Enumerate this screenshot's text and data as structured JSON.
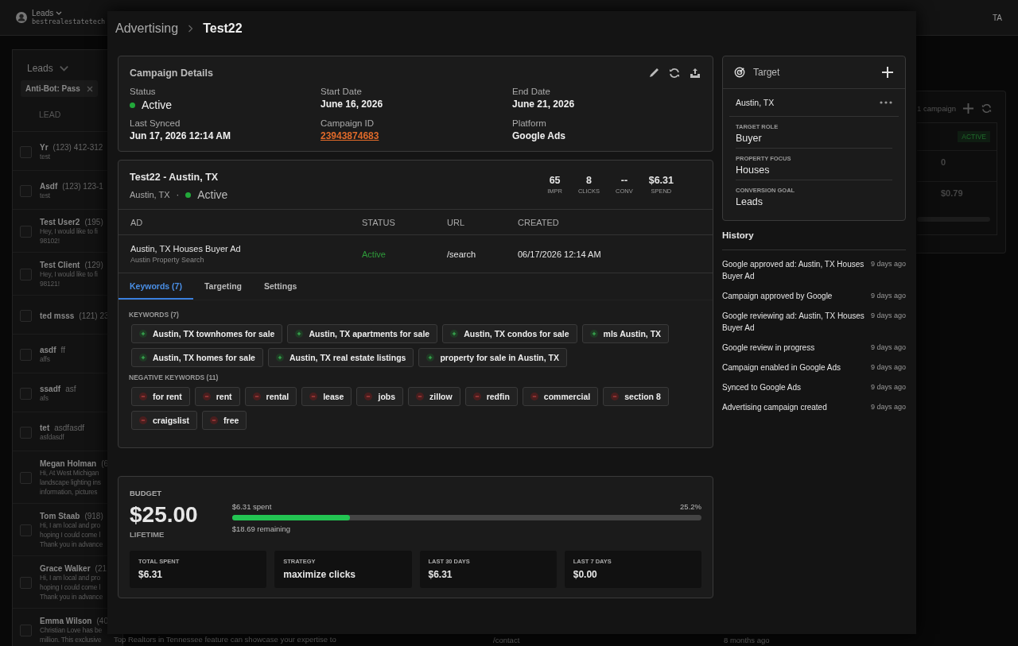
{
  "app_header": {
    "account_label": "Leads",
    "account_sub": "bestrealestatetech",
    "user_initials": "TA"
  },
  "leads_panel": {
    "title": "Leads",
    "filter_chip": "Anti-Bot: Pass",
    "column": "LEAD",
    "rows": [
      {
        "name": "Yr",
        "phone": "(123) 412-312",
        "preview": [
          "test"
        ],
        "checked": false
      },
      {
        "name": "Asdf",
        "phone": "(123) 123-1",
        "preview": [
          "test"
        ],
        "checked": false
      },
      {
        "name": "Test User2",
        "phone": "(195)",
        "preview": [
          "Hey, I would like to fi",
          "98102!"
        ],
        "checked": false
      },
      {
        "name": "Test Client",
        "phone": "(129)",
        "preview": [
          "Hey, I would like to fi",
          "98121!"
        ],
        "checked": false
      },
      {
        "name": "ted msss",
        "phone": "(121) 23",
        "preview": [],
        "checked": false
      },
      {
        "name": "asdf",
        "phone": "ff",
        "preview": [
          "affs"
        ],
        "checked": false
      },
      {
        "name": "ssadf",
        "phone": "asf",
        "preview": [
          "afs"
        ],
        "checked": false
      },
      {
        "name": "tet",
        "phone": "asdfasdf",
        "preview": [
          "asfdasdf"
        ],
        "checked": false
      },
      {
        "name": "Megan Holman",
        "phone": "(6",
        "preview": [
          "Hi, At West Michigan",
          "landscape lighting ins",
          "information, pictures"
        ],
        "checked": false
      },
      {
        "name": "Tom Staab",
        "phone": "(918)",
        "preview": [
          "Hi, I am local and pro",
          "hoping I could come l",
          "Thank you in advance"
        ],
        "checked": false
      },
      {
        "name": "Grace Walker",
        "phone": "(21",
        "preview": [
          "Hi, I am local and pro",
          "hoping I could come l",
          "Thank you in advance"
        ],
        "checked": false
      },
      {
        "name": "Emma Wilson",
        "phone": "(40",
        "preview": [
          "Christian Love has be",
          "million. This exclusive"
        ],
        "checked": false
      }
    ]
  },
  "background_panel": {
    "count": "1 campaign",
    "badge": "ACTIVE",
    "values": [
      "0",
      "$0.79"
    ]
  },
  "background_row": {
    "preview": "Top Realtors in Tennessee feature can showcase your expertise to",
    "url": "/contact",
    "time": "8 months ago"
  },
  "modal": {
    "breadcrumb": [
      "Advertising",
      "Test22"
    ],
    "campaign_details": {
      "title": "Campaign Details",
      "fields": [
        {
          "label": "Status",
          "value": "Active",
          "kind": "status",
          "active": true
        },
        {
          "label": "Start Date",
          "value": "June 16, 2026",
          "kind": "text"
        },
        {
          "label": "End Date",
          "value": "June 21, 2026",
          "kind": "text"
        },
        {
          "label": "Last Synced",
          "value": "Jun 17, 2026 12:14 AM",
          "kind": "text"
        },
        {
          "label": "Campaign ID",
          "value": "23943874683",
          "kind": "link"
        },
        {
          "label": "Platform",
          "value": "Google Ads",
          "kind": "text"
        }
      ]
    },
    "ad_group": {
      "title": "Test22 - Austin, TX",
      "location": "Austin, TX",
      "separator": "·",
      "status": "Active",
      "active": true,
      "stats": [
        {
          "value": "65",
          "label": "IMPR"
        },
        {
          "value": "8",
          "label": "CLICKS"
        },
        {
          "value": "--",
          "label": "CONV"
        },
        {
          "value": "$6.31",
          "label": "SPEND"
        }
      ],
      "table": {
        "columns": [
          "AD",
          "STATUS",
          "URL",
          "CREATED"
        ],
        "rows": [
          {
            "ad": "Austin, TX Houses Buyer Ad",
            "subtitle": "Austin Property Search",
            "status": "Active",
            "active": true,
            "url": "/search",
            "created": "06/17/2026 12:14 AM"
          }
        ]
      },
      "tabs": [
        {
          "label": "Keywords (7)",
          "selected": true
        },
        {
          "label": "Targeting",
          "selected": false
        },
        {
          "label": "Settings",
          "selected": false
        }
      ],
      "keyword_groups": [
        {
          "title": "KEYWORDS (7)",
          "kind": "positive",
          "keywords": [
            "Austin, TX townhomes for sale",
            "Austin, TX apartments for sale",
            "Austin, TX condos for sale",
            "mls Austin, TX",
            "Austin, TX homes for sale",
            "Austin, TX real estate listings",
            "property for sale in Austin, TX"
          ]
        },
        {
          "title": "NEGATIVE KEYWORDS (11)",
          "kind": "negative",
          "keywords": [
            "for rent",
            "rent",
            "rental",
            "lease",
            "jobs",
            "zillow",
            "redfin",
            "commercial",
            "section 8",
            "craigslist",
            "free"
          ]
        }
      ]
    },
    "budget": {
      "title": "BUDGET",
      "amount": "$25.00",
      "period": "LIFETIME",
      "spent": "$6.31 spent",
      "percent": "25.2%",
      "level": 0.252,
      "remaining": "$18.69 remaining",
      "stats": [
        {
          "label": "TOTAL SPENT",
          "value": "$6.31"
        },
        {
          "label": "STRATEGY",
          "value": "maximize clicks"
        },
        {
          "label": "LAST 30 DAYS",
          "value": "$6.31"
        },
        {
          "label": "LAST 7 DAYS",
          "value": "$0.00"
        }
      ]
    },
    "target": {
      "title": "Target",
      "location": "Austin, TX",
      "fields": [
        {
          "label": "TARGET ROLE",
          "value": "Buyer"
        },
        {
          "label": "PROPERTY FOCUS",
          "value": "Houses"
        },
        {
          "label": "CONVERSION GOAL",
          "value": "Leads"
        }
      ]
    },
    "history": {
      "title": "History",
      "items": [
        {
          "text": "Google approved ad: Austin, TX Houses Buyer Ad",
          "time": "9 days ago"
        },
        {
          "text": "Campaign approved by Google",
          "time": "9 days ago"
        },
        {
          "text": "Google reviewing ad: Austin, TX Houses Buyer Ad",
          "time": "9 days ago"
        },
        {
          "text": "Google review in progress",
          "time": "9 days ago"
        },
        {
          "text": "Campaign enabled in Google Ads",
          "time": "9 days ago"
        },
        {
          "text": "Synced to Google Ads",
          "time": "9 days ago"
        },
        {
          "text": "Advertising campaign created",
          "time": "9 days ago"
        }
      ]
    }
  }
}
